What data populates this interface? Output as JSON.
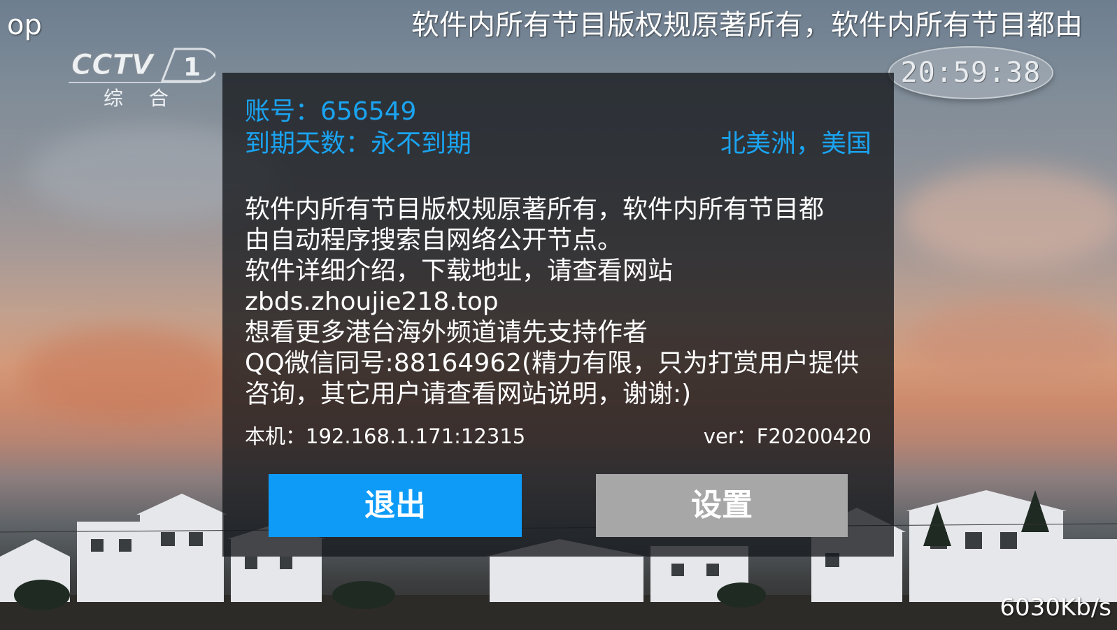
{
  "ticker": {
    "left_fragment": "op",
    "text": "软件内所有节目版权规原著所有，软件内所有节目都由"
  },
  "channel": {
    "logo_text": "CCTV",
    "number": "1",
    "name": "综 合"
  },
  "clock": "20:59:38",
  "dialog": {
    "account": "账号：656549",
    "expiry": "到期天数：永不到期",
    "region": "北美洲，美国",
    "notice_lines": [
      "软件内所有节目版权规原著所有，软件内所有节目都",
      "由自动程序搜索自网络公开节点。",
      "软件详细介绍，下载地址，请查看网站",
      "zbds.zhoujie218.top",
      "想看更多港台海外频道请先支持作者",
      "QQ微信同号:88164962(精力有限，只为打赏用户提供",
      "咨询，其它用户请查看网站说明，谢谢:)"
    ],
    "local_address": "本机：192.168.1.171:12315",
    "version": "ver：F20200420",
    "exit_label": "退出",
    "settings_label": "设置"
  },
  "bitrate": "6030Kb/s",
  "colors": {
    "accent_blue": "#0d9bf7",
    "info_blue": "#1aa4f2",
    "button_gray": "#a7a7a7",
    "dialog_bg": "#16181c"
  }
}
